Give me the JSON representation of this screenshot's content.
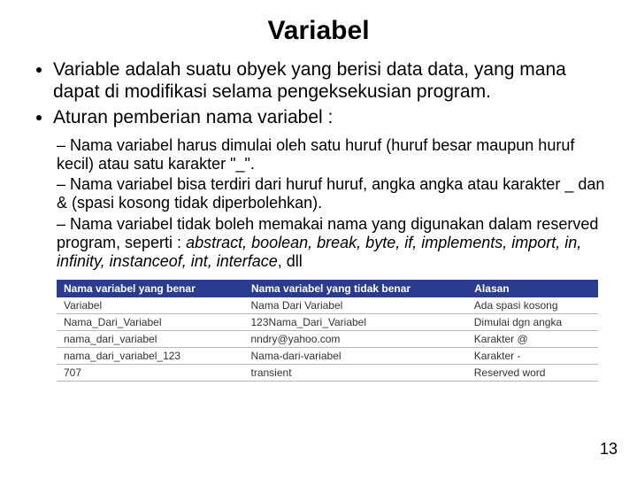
{
  "title": "Variabel",
  "bullets": [
    "Variable adalah suatu obyek yang berisi data data, yang mana dapat di modifikasi selama pengeksekusian program.",
    "Aturan pemberian nama variabel :"
  ],
  "sub": [
    {
      "text": "Nama variabel harus dimulai oleh satu huruf (huruf besar maupun huruf kecil) atau satu karakter \"_\"."
    },
    {
      "text": "Nama variabel bisa terdiri dari huruf huruf, angka angka atau karakter _ dan & (spasi kosong tidak diperbolehkan)."
    },
    {
      "prefix": "Nama variabel tidak boleh memakai nama yang digunakan dalam reserved program, seperti : ",
      "italic": "abstract, boolean, break, byte, if, implements, import, in, infinity, instanceof, int, interface",
      "suffix": ", dll"
    }
  ],
  "table": {
    "headers": [
      "Nama variabel yang benar",
      "Nama variabel yang tidak benar",
      "Alasan"
    ],
    "rows": [
      [
        "Variabel",
        "Nama Dari Variabel",
        "Ada spasi kosong"
      ],
      [
        "Nama_Dari_Variabel",
        "123Nama_Dari_Variabel",
        "Dimulai dgn angka"
      ],
      [
        "nama_dari_variabel",
        "nndry@yahoo.com",
        "Karakter @"
      ],
      [
        "nama_dari_variabel_123",
        "Nama-dari-variabel",
        "Karakter -"
      ],
      [
        "707",
        "transient",
        "Reserved word"
      ]
    ]
  },
  "page": "13"
}
